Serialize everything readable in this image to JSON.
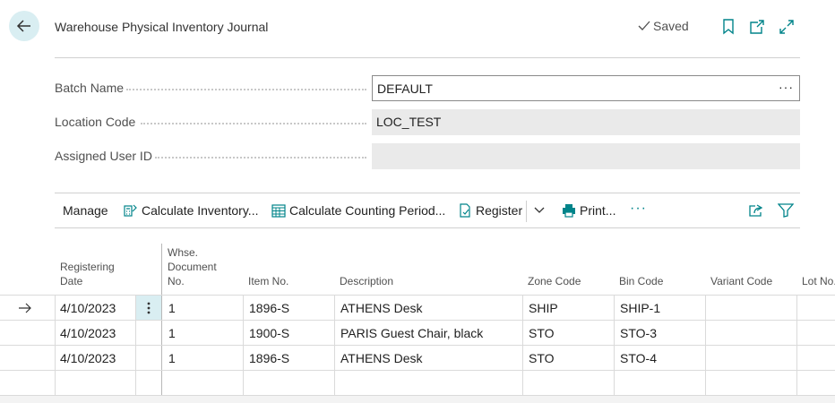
{
  "header": {
    "title": "Warehouse Physical Inventory Journal",
    "saved_label": "Saved"
  },
  "fields": [
    {
      "label": "Batch Name",
      "value": "DEFAULT"
    },
    {
      "label": "Location Code",
      "value": "LOC_TEST"
    },
    {
      "label": "Assigned User ID",
      "value": ""
    }
  ],
  "actions": {
    "manage": "Manage",
    "calculate_inventory": "Calculate Inventory...",
    "calculate_counting_period": "Calculate Counting Period...",
    "register": "Register",
    "print": "Print..."
  },
  "grid": {
    "columns": [
      "Registering Date",
      "Whse. Document No.",
      "Item No.",
      "Description",
      "Zone Code",
      "Bin Code",
      "Variant Code",
      "Lot No."
    ],
    "rows": [
      {
        "date": "4/10/2023",
        "doc_no": "1",
        "item_no": "1896-S",
        "description": "ATHENS Desk",
        "zone": "SHIP",
        "bin": "SHIP-1",
        "variant": "",
        "lot": ""
      },
      {
        "date": "4/10/2023",
        "doc_no": "1",
        "item_no": "1900-S",
        "description": "PARIS Guest Chair, black",
        "zone": "STO",
        "bin": "STO-3",
        "variant": "",
        "lot": ""
      },
      {
        "date": "4/10/2023",
        "doc_no": "1",
        "item_no": "1896-S",
        "description": "ATHENS Desk",
        "zone": "STO",
        "bin": "STO-4",
        "variant": "",
        "lot": ""
      }
    ]
  },
  "colors": {
    "accent": "#00848a",
    "selection": "#d9eef2"
  },
  "icons": [
    "back-arrow-icon",
    "checkmark-icon",
    "bookmark-icon",
    "open-new-window-icon",
    "expand-icon",
    "calculate-icon",
    "calendar-grid-icon",
    "register-icon",
    "chevron-down-icon",
    "printer-icon",
    "more-icon",
    "share-icon",
    "filter-icon",
    "row-arrow-icon",
    "row-menu-icon"
  ]
}
